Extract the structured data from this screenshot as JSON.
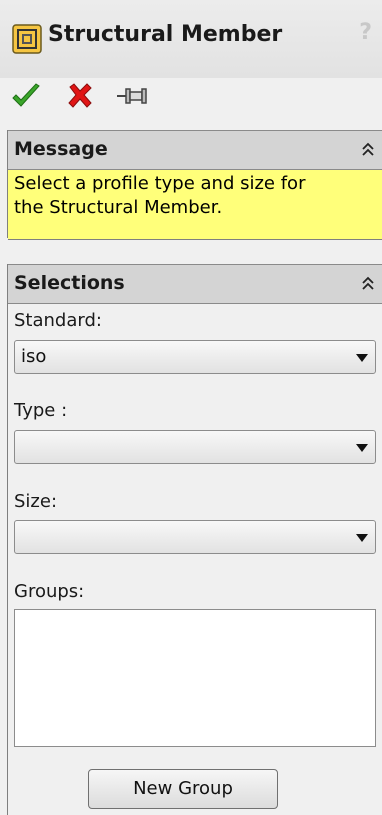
{
  "title_bar": {
    "title": "Structural Member",
    "help_glyph": "?",
    "icon": "structural-member-icon"
  },
  "actions": {
    "ok_icon": "checkmark-icon",
    "cancel_icon": "red-x-icon",
    "pin_icon": "pushpin-icon",
    "ok_color": "#3aa52a",
    "cancel_color": "#e01515"
  },
  "message": {
    "header": "Message",
    "text_line1": "Select a profile type and size for",
    "text_line2": "the Structural Member.",
    "background": "#ffff7a"
  },
  "selections": {
    "header": "Selections",
    "standard": {
      "label": "Standard:",
      "value": "iso"
    },
    "type": {
      "label": "Type :",
      "value": ""
    },
    "size": {
      "label": "Size:",
      "value": ""
    },
    "groups": {
      "label": "Groups:",
      "items": []
    },
    "new_group_button": "New Group"
  }
}
